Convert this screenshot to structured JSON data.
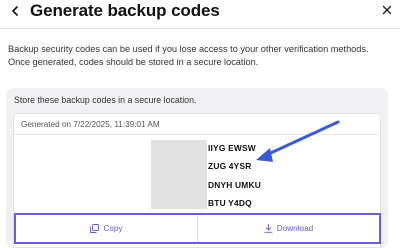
{
  "header": {
    "title": "Generate backup codes"
  },
  "intro": {
    "text": "Backup security codes can be used if you lose access to your other verification methods. Once generated, codes should be stored in a secure location."
  },
  "card": {
    "label": "Store these backup codes in a secure location.",
    "generated": "Generated on 7/22/2025, 11:39:01 AM",
    "codes": [
      "IIYG EWSW",
      "ZUG 4YSR",
      "DNYH UMKU",
      "BTU Y4DQ"
    ]
  },
  "actions": {
    "copy_label": "Copy",
    "download_label": "Download"
  },
  "colors": {
    "accent": "#6a5acd",
    "annotation_arrow": "#3a5bd9"
  },
  "icons": {
    "back": "chevron-left-icon",
    "close": "close-icon",
    "copy": "copy-icon",
    "download": "download-icon",
    "annotation": "arrow-icon"
  }
}
